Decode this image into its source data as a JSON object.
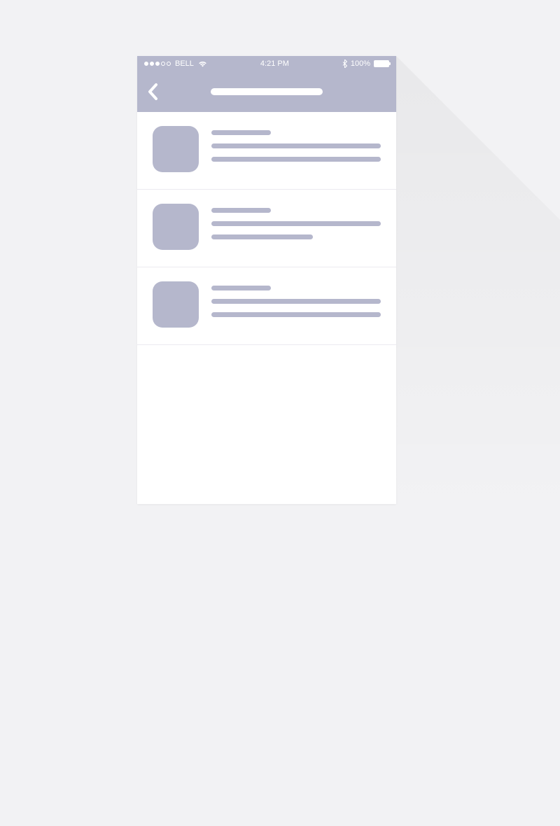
{
  "status": {
    "carrier": "BELL",
    "time": "4:21 PM",
    "battery_pct": "100%"
  },
  "colors": {
    "accent": "#b5b7cc",
    "background": "#f2f2f4"
  },
  "list": {
    "items": [
      {
        "line3_variant": "full"
      },
      {
        "line3_variant": "mid"
      },
      {
        "line3_variant": "full"
      }
    ]
  }
}
